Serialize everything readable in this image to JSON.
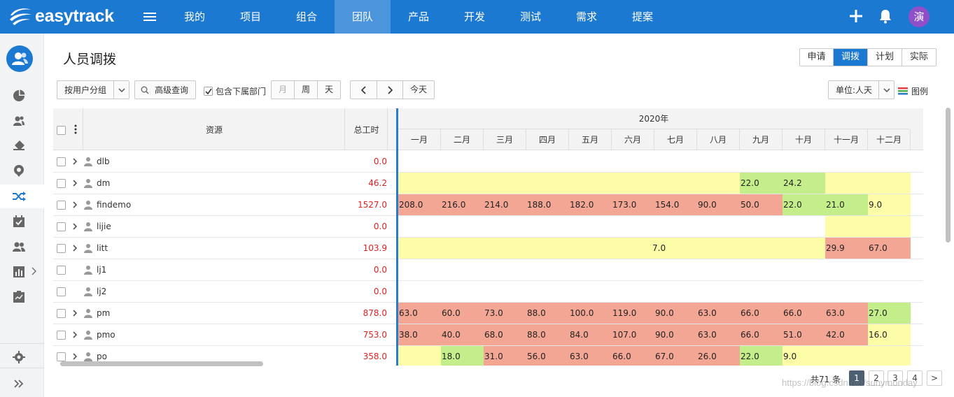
{
  "app": {
    "logo_text": "easytrack",
    "avatar_text": "演"
  },
  "nav": {
    "items": [
      "我的",
      "项目",
      "组合",
      "团队",
      "产品",
      "开发",
      "测试",
      "需求",
      "提案"
    ],
    "active_index": 3
  },
  "header": {
    "title": "人员调拨"
  },
  "view_tabs": {
    "items": [
      "申请",
      "调拨",
      "计划",
      "实际"
    ],
    "active_index": 1
  },
  "toolbar": {
    "group_by": "按用户分组",
    "advanced_search": "高级查询",
    "include_sub": "包含下属部门",
    "period_buttons": [
      "月",
      "周",
      "天"
    ],
    "today": "今天",
    "unit": "单位:人天",
    "legend": "图例"
  },
  "grid": {
    "columns": {
      "resource": "资源",
      "total": "总工时"
    },
    "year": "2020年",
    "months": [
      "一月",
      "二月",
      "三月",
      "四月",
      "五月",
      "六月",
      "七月",
      "八月",
      "九月",
      "十月",
      "十一月",
      "十二月"
    ],
    "rows": [
      {
        "name": "dlb",
        "total": "0.0",
        "expandable": true,
        "cells": []
      },
      {
        "name": "dm",
        "total": "46.2",
        "expandable": true,
        "cells": [
          [
            "y",
            "",
            0,
            8
          ],
          [
            "g",
            "22.0",
            8,
            1
          ],
          [
            "g",
            "24.2",
            9,
            1
          ],
          [
            "y",
            "",
            10,
            2
          ]
        ]
      },
      {
        "name": "findemo",
        "total": "1527.0",
        "expandable": true,
        "cells": [
          [
            "r",
            "208.0",
            0,
            1
          ],
          [
            "r",
            "216.0",
            1,
            1
          ],
          [
            "r",
            "214.0",
            2,
            1
          ],
          [
            "r",
            "188.0",
            3,
            1
          ],
          [
            "r",
            "182.0",
            4,
            1
          ],
          [
            "r",
            "173.0",
            5,
            1
          ],
          [
            "r",
            "154.0",
            6,
            1
          ],
          [
            "r",
            "90.0",
            7,
            1
          ],
          [
            "r",
            "50.0",
            8,
            1
          ],
          [
            "g",
            "22.0",
            9,
            1
          ],
          [
            "g",
            "21.0",
            10,
            1
          ],
          [
            "y",
            "9.0",
            11,
            1
          ]
        ]
      },
      {
        "name": "lijie",
        "total": "0.0",
        "expandable": true,
        "cells": [
          [
            "y",
            "",
            10,
            2
          ]
        ]
      },
      {
        "name": "litt",
        "total": "103.9",
        "expandable": true,
        "cells": [
          [
            "y",
            "",
            0,
            6
          ],
          [
            "y",
            "7.0",
            6,
            4
          ],
          [
            "r",
            "29.9",
            10,
            1
          ],
          [
            "r",
            "67.0",
            11,
            1
          ]
        ]
      },
      {
        "name": "lj1",
        "total": "0.0",
        "expandable": false,
        "cells": []
      },
      {
        "name": "lj2",
        "total": "0.0",
        "expandable": false,
        "cells": []
      },
      {
        "name": "pm",
        "total": "878.0",
        "expandable": true,
        "cells": [
          [
            "r",
            "63.0",
            0,
            1
          ],
          [
            "r",
            "60.0",
            1,
            1
          ],
          [
            "r",
            "73.0",
            2,
            1
          ],
          [
            "r",
            "88.0",
            3,
            1
          ],
          [
            "r",
            "100.0",
            4,
            1
          ],
          [
            "r",
            "119.0",
            5,
            1
          ],
          [
            "r",
            "90.0",
            6,
            1
          ],
          [
            "r",
            "63.0",
            7,
            1
          ],
          [
            "r",
            "66.0",
            8,
            1
          ],
          [
            "r",
            "66.0",
            9,
            1
          ],
          [
            "r",
            "63.0",
            10,
            1
          ],
          [
            "g",
            "27.0",
            11,
            1
          ]
        ]
      },
      {
        "name": "pmo",
        "total": "753.0",
        "expandable": true,
        "cells": [
          [
            "r",
            "38.0",
            0,
            1
          ],
          [
            "r",
            "40.0",
            1,
            1
          ],
          [
            "r",
            "68.0",
            2,
            1
          ],
          [
            "r",
            "88.0",
            3,
            1
          ],
          [
            "r",
            "84.0",
            4,
            1
          ],
          [
            "r",
            "107.0",
            5,
            1
          ],
          [
            "r",
            "90.0",
            6,
            1
          ],
          [
            "r",
            "63.0",
            7,
            1
          ],
          [
            "r",
            "66.0",
            8,
            1
          ],
          [
            "r",
            "51.0",
            9,
            1
          ],
          [
            "r",
            "42.0",
            10,
            1
          ],
          [
            "y",
            "16.0",
            11,
            1
          ]
        ]
      },
      {
        "name": "po",
        "total": "358.0",
        "expandable": true,
        "cells": [
          [
            "y",
            "",
            0,
            1
          ],
          [
            "g",
            "18.0",
            1,
            1
          ],
          [
            "r",
            "31.0",
            2,
            1
          ],
          [
            "r",
            "56.0",
            3,
            1
          ],
          [
            "r",
            "63.0",
            4,
            1
          ],
          [
            "r",
            "66.0",
            5,
            1
          ],
          [
            "r",
            "67.0",
            6,
            1
          ],
          [
            "r",
            "26.0",
            7,
            1
          ],
          [
            "g",
            "22.0",
            8,
            1
          ],
          [
            "y",
            "9.0",
            9,
            1
          ],
          [
            "y",
            "",
            10,
            2
          ]
        ]
      }
    ]
  },
  "colors": {
    "red": "#f4a695",
    "green": "#c4ee8a",
    "yellow": "#fefda7",
    "brand": "#1c79d1"
  },
  "pagination": {
    "total_text": "共71 条",
    "pages": [
      "1",
      "2",
      "3",
      "4"
    ],
    "active": "1",
    "next": ">"
  },
  "watermark": "https://blog.csdn.net/sunymonday"
}
